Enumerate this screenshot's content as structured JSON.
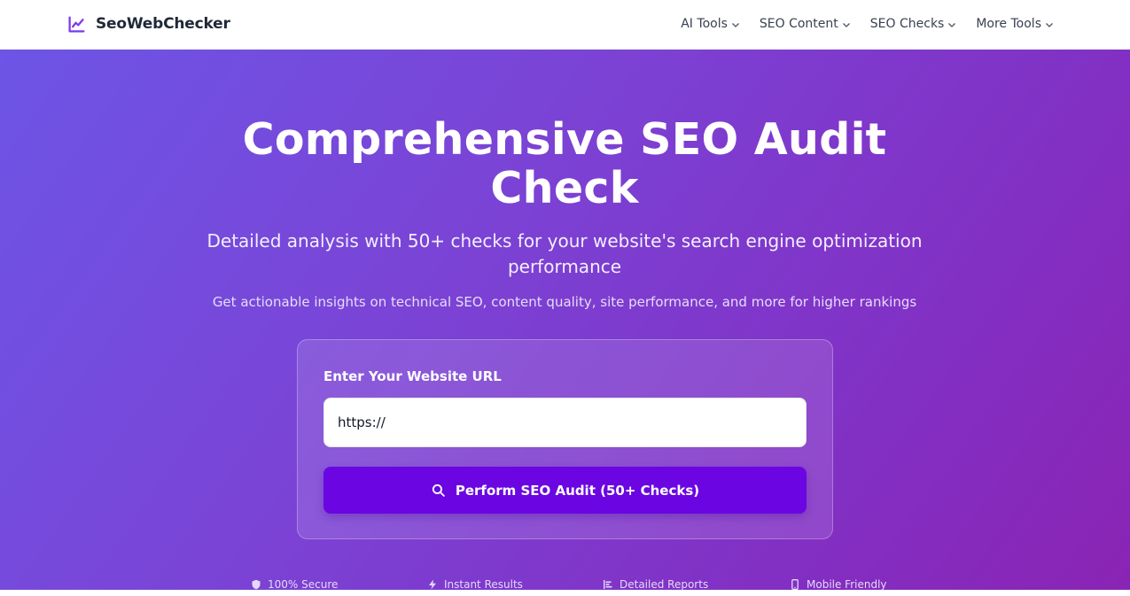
{
  "brand": {
    "name": "SeoWebChecker",
    "icon": "trend-chart-icon",
    "color": "#7c3aed"
  },
  "nav": {
    "items": [
      {
        "label": "AI Tools"
      },
      {
        "label": "SEO Content"
      },
      {
        "label": "SEO Checks"
      },
      {
        "label": "More Tools"
      }
    ]
  },
  "hero": {
    "title_line1": "Comprehensive SEO Audit",
    "title_line2": "Check",
    "subtitle_line1": "Detailed analysis with 50+ checks for your website's search engine optimization",
    "subtitle_line2": "performance",
    "note": "Get actionable insights on technical SEO, content quality, site performance, and more for higher rankings",
    "gradient_start": "#6d55e6",
    "gradient_end": "#8a24b4"
  },
  "form": {
    "label": "Enter Your Website URL",
    "url_value": "https://",
    "button_label": "Perform SEO Audit (50+ Checks)",
    "button_icon": "search-icon",
    "button_color": "#6b06e2"
  },
  "features": [
    {
      "label": "100% Secure",
      "icon": "shield-icon"
    },
    {
      "label": "Instant Results",
      "icon": "bolt-icon"
    },
    {
      "label": "Detailed Reports",
      "icon": "bar-list-icon"
    },
    {
      "label": "Mobile Friendly",
      "icon": "mobile-icon"
    }
  ]
}
